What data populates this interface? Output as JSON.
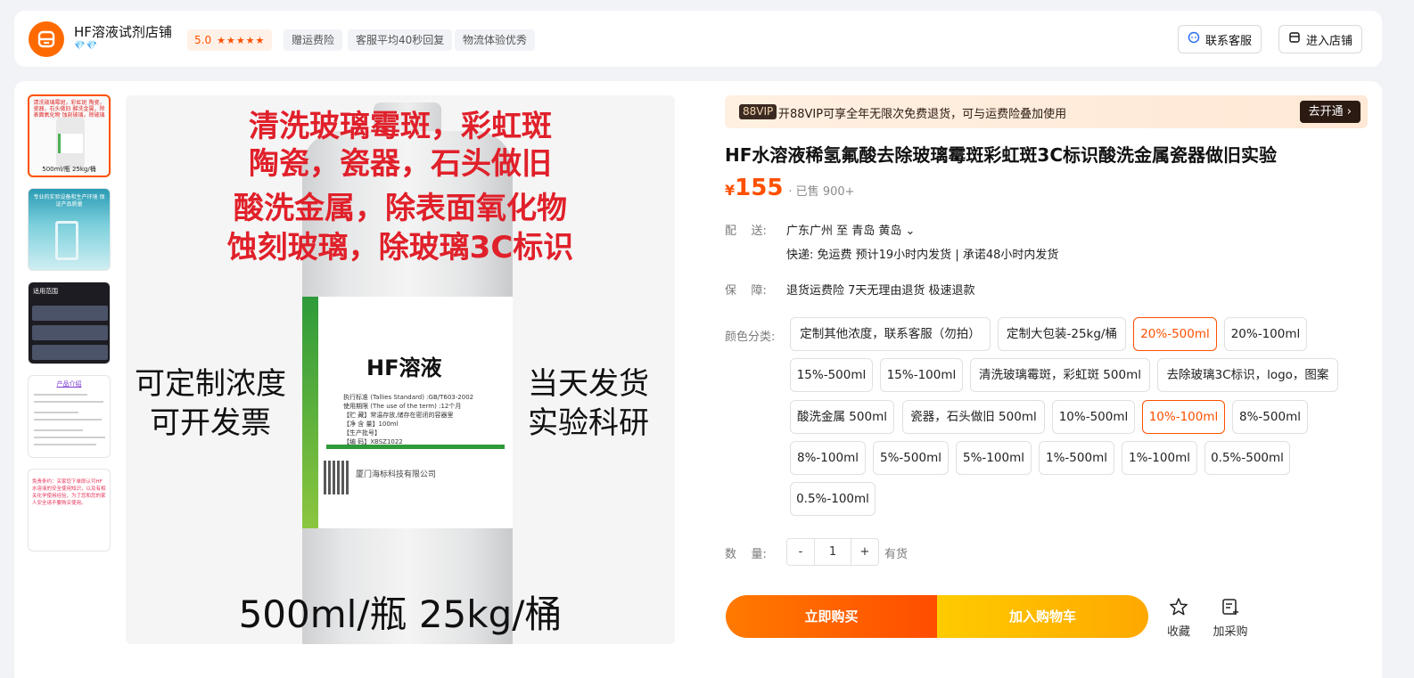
{
  "shop": {
    "name": "HF溶液试剂店铺",
    "diamonds": "💎💎",
    "rating_score": "5.0",
    "stars": "★★★★★",
    "tags": [
      "赠运费险",
      "客服平均40秒回复",
      "物流体验优秀"
    ],
    "contact_button": "联系客服",
    "enter_button": "进入店铺"
  },
  "gallery": {
    "thumb1_text": "清洗玻璃霉斑，彩虹斑 陶瓷，瓷器，石头做旧 酸洗金属，除表面氧化物 蚀刻玻璃，除玻璃3C标识",
    "thumb1_bottom": "500ml/瓶 25kg/桶",
    "thumb2_text": "专业的实验设备和生产环境 保证产品质量",
    "thumb3_text": "适用范围",
    "thumb4_text": "产品介绍",
    "thumb5_text": "免责条约：买家您下单即认可HF水溶液的安全使用知识，以及有相关化学使用经验，为了您和您的家人安全请不要购买使用。",
    "main": {
      "red_lines": [
        "清洗玻璃霉斑，彩虹斑",
        "陶瓷，瓷器，石头做旧",
        "酸洗金属，除表面氧化物",
        "蚀刻玻璃，除玻璃3C标识"
      ],
      "left_lines": [
        "可定制浓度",
        "可开发票"
      ],
      "right_lines": [
        "当天发货",
        "实验科研"
      ],
      "bottle_label": "HF溶液",
      "label_lines": [
        "执行标准 (Tallies Standard) :GB/T603-2002",
        "使用期限 (The use of the term) :12个月",
        "【贮  藏】常温存放,储存在密闭的容器里",
        "【净  含  量】100ml",
        "【生产批号】",
        "【编  码】XBSZ1022"
      ],
      "label_company": "厦门海标科技有限公司",
      "bottom_text": "500ml/瓶  25kg/桶"
    }
  },
  "vip": {
    "badge": "88VIP",
    "text": "开88VIP可享全年无限次免费退货，可与运费险叠加使用",
    "button": "去开通 ›"
  },
  "product": {
    "title": "HF水溶液稀氢氟酸去除玻璃霉斑彩虹斑3C标识酸洗金属瓷器做旧实验",
    "currency": "¥",
    "price": "155",
    "sold": "· 已售 900+"
  },
  "delivery": {
    "label": "配    送:",
    "route": "广东广州   至   青岛 黄岛 ⌄",
    "detail": "快递: 免运费   预计19小时内发货 | 承诺48小时内发货"
  },
  "guarantee": {
    "label": "保    障:",
    "text": "退货运费险 7天无理由退货 极速退款"
  },
  "sku_section": {
    "label": "颜色分类:",
    "options": [
      {
        "label": "定制其他浓度，联系客服（勿拍）",
        "selected": false
      },
      {
        "label": "定制大包装-25kg/桶",
        "selected": false
      },
      {
        "label": "20%-500ml",
        "selected": true
      },
      {
        "label": "20%-100ml",
        "selected": false
      },
      {
        "label": "15%-500ml",
        "selected": false
      },
      {
        "label": "15%-100ml",
        "selected": false
      },
      {
        "label": "清洗玻璃霉斑，彩虹斑 500ml",
        "selected": false
      },
      {
        "label": "去除玻璃3C标识，logo，图案",
        "selected": false
      },
      {
        "label": "酸洗金属 500ml",
        "selected": false
      },
      {
        "label": "瓷器，石头做旧 500ml",
        "selected": false
      },
      {
        "label": "10%-500ml",
        "selected": false
      },
      {
        "label": "10%-100ml",
        "selected": true
      },
      {
        "label": "8%-500ml",
        "selected": false
      },
      {
        "label": "8%-100ml",
        "selected": false
      },
      {
        "label": "5%-500ml",
        "selected": false
      },
      {
        "label": "5%-100ml",
        "selected": false
      },
      {
        "label": "1%-500ml",
        "selected": false
      },
      {
        "label": "1%-100ml",
        "selected": false
      },
      {
        "label": "0.5%-500ml",
        "selected": false
      },
      {
        "label": "0.5%-100ml",
        "selected": false
      }
    ]
  },
  "quantity": {
    "label": "数    量:",
    "minus": "-",
    "value": "1",
    "plus": "+",
    "stock": "有货"
  },
  "actions": {
    "buy": "立即购买",
    "cart": "加入购物车",
    "favorite": "收藏",
    "purchase_list": "加采购"
  },
  "colors": {
    "accent": "#ff5000",
    "buy_gradient": [
      "#ff7a00",
      "#ff4d00"
    ],
    "cart_gradient": [
      "#ffcb00",
      "#ffa800"
    ]
  }
}
